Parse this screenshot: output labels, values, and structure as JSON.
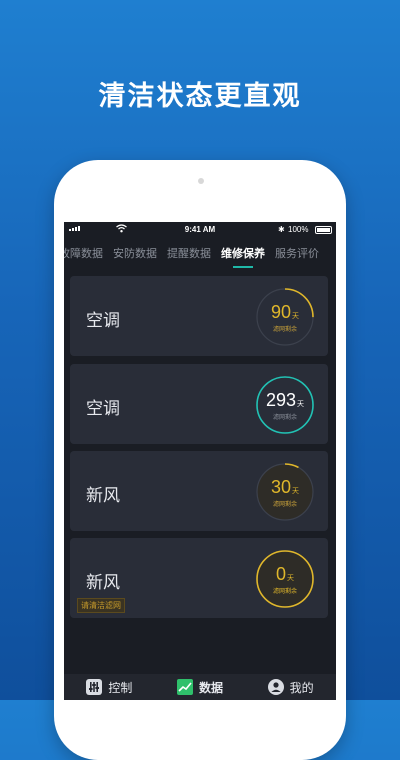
{
  "headline": "清洁状态更直观",
  "status_bar": {
    "time": "9:41 AM",
    "battery": "100%"
  },
  "tabs": [
    {
      "label": "故障数据",
      "active": false
    },
    {
      "label": "安防数据",
      "active": false
    },
    {
      "label": "提醒数据",
      "active": false
    },
    {
      "label": "维修保养",
      "active": true
    },
    {
      "label": "服务评价",
      "active": false
    }
  ],
  "cards": [
    {
      "name": "空调",
      "days": "90",
      "unit": "天",
      "sub": "滤网剩余",
      "level": 0.25,
      "color": "#e0b72b",
      "highlight": false
    },
    {
      "name": "空调",
      "days": "293",
      "unit": "天",
      "sub": "滤网剩余",
      "level": 1.0,
      "color": "#21c2b4",
      "highlight": false
    },
    {
      "name": "新风",
      "days": "30",
      "unit": "天",
      "sub": "滤网剩余",
      "level": 0.08,
      "color": "#e0b72b",
      "highlight": true
    },
    {
      "name": "新风",
      "days": "0",
      "unit": "天",
      "sub": "滤网剩余",
      "level": 1.0,
      "color": "#e0b72b",
      "highlight": true,
      "hint": "请清洁滤网"
    }
  ],
  "bottom_nav": [
    {
      "label": "控制",
      "icon": "sliders-icon",
      "active": false
    },
    {
      "label": "数据",
      "icon": "chart-icon",
      "active": true
    },
    {
      "label": "我的",
      "icon": "user-icon",
      "active": false
    }
  ]
}
